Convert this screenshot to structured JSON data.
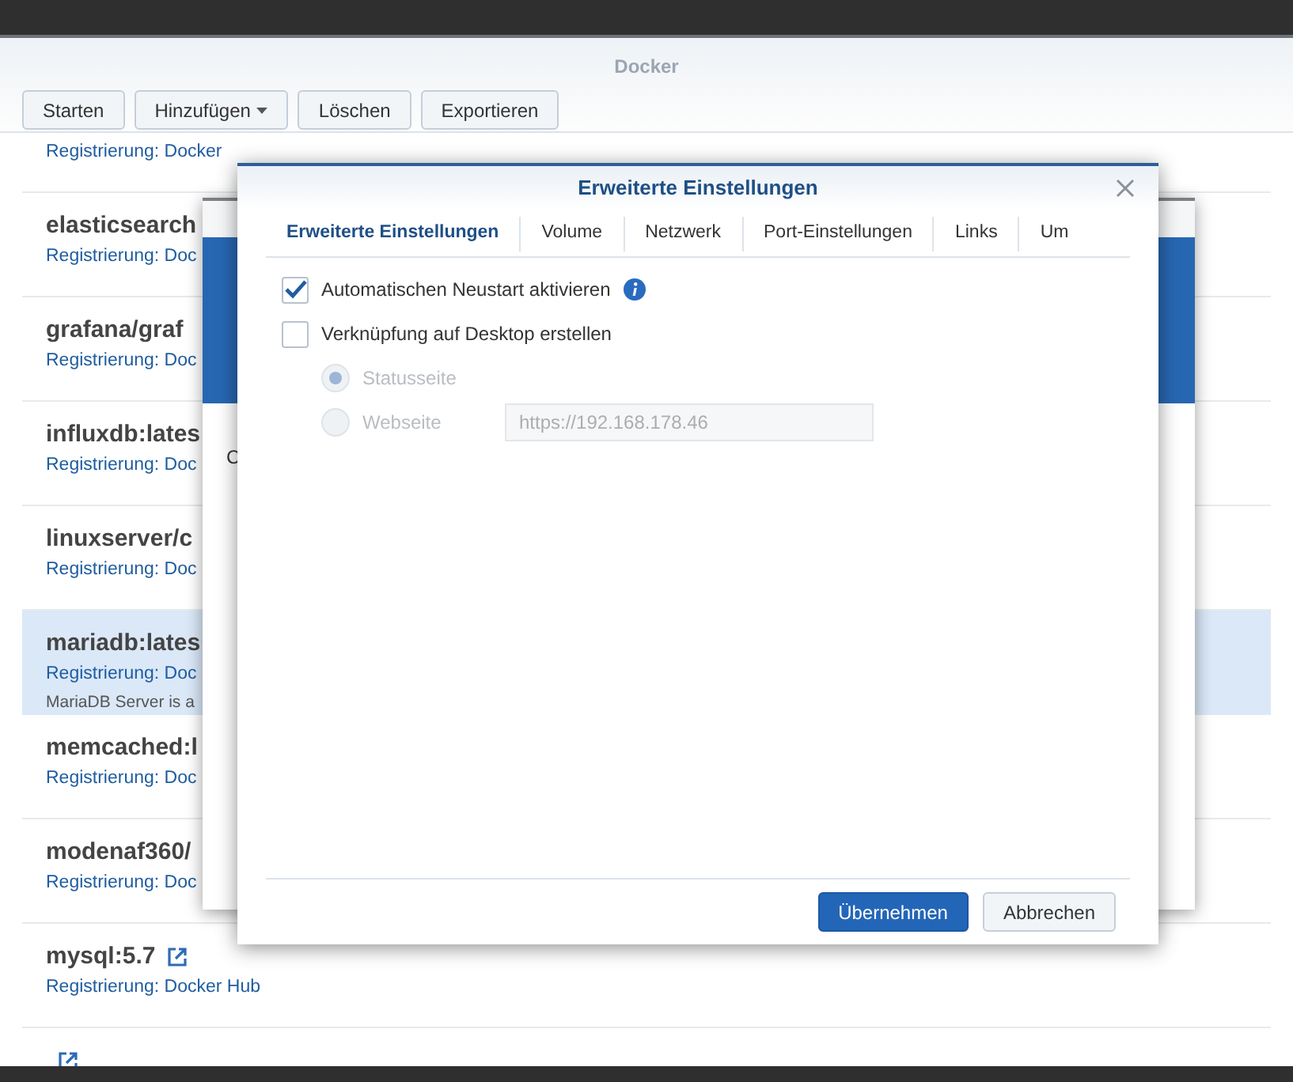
{
  "app_window": {
    "title": "Docker"
  },
  "toolbar": [
    {
      "label": "Starten",
      "dropdown": false
    },
    {
      "label": "Hinzufügen",
      "dropdown": true
    },
    {
      "label": "Löschen",
      "dropdown": false
    },
    {
      "label": "Exportieren",
      "dropdown": false
    }
  ],
  "images": [
    {
      "registry": "Registrierung: Docker",
      "link_icon": false,
      "selected": false
    },
    {
      "name": "elasticsearch",
      "registry": "Registrierung: Doc",
      "link_icon": false,
      "selected": false
    },
    {
      "name": "grafana/graf",
      "registry": "Registrierung: Doc",
      "link_icon": false,
      "selected": false
    },
    {
      "name": "influxdb:lates",
      "registry": "Registrierung: Doc",
      "link_icon": false,
      "selected": false
    },
    {
      "name": "linuxserver/c",
      "registry": "Registrierung: Doc",
      "link_icon": false,
      "selected": false
    },
    {
      "name": "mariadb:lates",
      "registry": "Registrierung: Doc",
      "description": "MariaDB Server is a",
      "link_icon": false,
      "selected": true
    },
    {
      "name": "memcached:l",
      "registry": "Registrierung: Doc",
      "link_icon": false,
      "selected": false
    },
    {
      "name": "modenaf360/",
      "registry": "Registrierung: Doc",
      "link_icon": false,
      "selected": false
    },
    {
      "name": "mysql:5.7",
      "registry": "Registrierung: Docker Hub",
      "link_icon": true,
      "selected": false
    },
    {
      "link_icon": true,
      "selected": false
    }
  ],
  "background_dialog": {
    "body_text": "C"
  },
  "dialog": {
    "title": "Erweiterte Einstellungen",
    "tabs": [
      {
        "label": "Erweiterte Einstellungen",
        "selected": true
      },
      {
        "label": "Volume",
        "selected": false
      },
      {
        "label": "Netzwerk",
        "selected": false
      },
      {
        "label": "Port-Einstellungen",
        "selected": false
      },
      {
        "label": "Links",
        "selected": false
      },
      {
        "label": "Um",
        "selected": false
      }
    ],
    "options": [
      {
        "kind": "checkbox",
        "label": "Automatischen Neustart aktivieren",
        "checked": true,
        "info": true
      },
      {
        "kind": "checkbox",
        "label": "Verknüpfung auf Desktop erstellen",
        "checked": false,
        "info": false
      },
      {
        "kind": "radio",
        "label": "Statusseite",
        "selected": true,
        "disabled": true
      },
      {
        "kind": "radio",
        "label": "Webseite",
        "selected": false,
        "disabled": true,
        "value": "https://192.168.178.46"
      }
    ],
    "buttons": [
      {
        "label": "Übernehmen",
        "primary": true
      },
      {
        "label": "Abbrechen",
        "primary": false
      }
    ]
  }
}
